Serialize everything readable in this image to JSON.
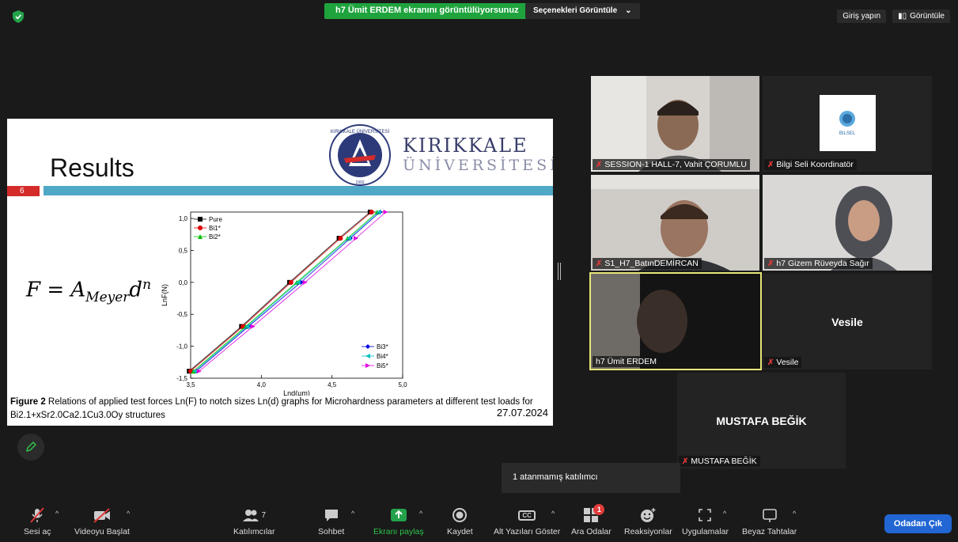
{
  "top": {
    "share_banner": "h7 Ümit ERDEM ekranını görüntülüyorsunuz",
    "view_options": "Seçenekleri Görüntüle",
    "signin": "Giriş yapın",
    "view": "Görüntüle"
  },
  "slide": {
    "title": "Results",
    "slide_number": "6",
    "university_line1": "KIRIKKALE",
    "university_line2": "ÜNİVERSİTESİ",
    "seal_text": "KIRIKKALE ÜNİVERSİTESİ",
    "seal_year": "1992",
    "formula_F": "F",
    "formula_eq": "=",
    "formula_A": "A",
    "formula_sub": "Meyer",
    "formula_d": "d",
    "formula_n": "n",
    "caption_bold": "Figure 2",
    "caption_text": " Relations of applied test forces Ln(F) to notch sizes Ln(d) graphs for Microhardness parameters at different test loads for",
    "caption_formula": "Bi2.1+xSr2.0Ca2.1Cu3.0Oy structures",
    "date": "27.07.2024"
  },
  "chart_data": {
    "type": "scatter",
    "xlabel": "Lnd(µm)",
    "ylabel": "LnF(N)",
    "xlim": [
      3.5,
      5.0
    ],
    "ylim": [
      -1.5,
      1.1
    ],
    "xticks": [
      "3,5",
      "4,0",
      "4,5",
      "5,0"
    ],
    "yticks": [
      "-1,5",
      "-1,0",
      "-0,5",
      "0,0",
      "0,5",
      "1,0"
    ],
    "x_tick_values": [
      3.5,
      4.0,
      4.5,
      5.0
    ],
    "y_tick_values": [
      -1.5,
      -1.0,
      -0.5,
      0.0,
      0.5,
      1.0
    ],
    "y_points": [
      -1.39,
      -0.69,
      0.0,
      0.69,
      1.1
    ],
    "series": [
      {
        "name": "Pure",
        "color": "#000000",
        "marker": "square",
        "x": [
          3.49,
          3.86,
          4.2,
          4.55,
          4.77
        ]
      },
      {
        "name": "Bi1*",
        "color": "#e00000",
        "marker": "circle",
        "x": [
          3.5,
          3.87,
          4.21,
          4.56,
          4.78
        ]
      },
      {
        "name": "Bi2*",
        "color": "#00c000",
        "marker": "triangle-up",
        "x": [
          3.52,
          3.89,
          4.25,
          4.61,
          4.82
        ]
      },
      {
        "name": "Bi3*",
        "color": "#0000e0",
        "marker": "diamond",
        "x": [
          3.54,
          3.91,
          4.28,
          4.63,
          4.84
        ]
      },
      {
        "name": "Bi4*",
        "color": "#00c0c0",
        "marker": "triangle-left",
        "x": [
          3.53,
          3.9,
          4.26,
          4.62,
          4.83
        ]
      },
      {
        "name": "Bi5*",
        "color": "#e000e0",
        "marker": "triangle-right",
        "x": [
          3.56,
          3.94,
          4.31,
          4.67,
          4.88
        ]
      }
    ]
  },
  "participants": {
    "vahit": "SESSION-1 HALL-7, Vahit ÇORUMLU",
    "bilgi": "Bilgi Seli Koordinatör",
    "bilsel_logo_text": "BILSEL",
    "batin": "S1_H7_BatınDEMİRCAN",
    "gizem": "h7 Gizem Rüveyda Sağır",
    "umit": "h7 Ümit ERDEM",
    "vesile_center": "Vesile",
    "vesile": "Vesile",
    "mustafa_center": "MUSTAFA BEĞİK",
    "mustafa": "MUSTAFA BEĞİK"
  },
  "tooltip": "1 atanmamış katılımcı",
  "toolbar": {
    "mute": "Sesi aç",
    "video": "Videoyu Başlat",
    "participants": "Katılımcılar",
    "participants_count": "7",
    "chat": "Sohbet",
    "share": "Ekranı paylaş",
    "record": "Kaydet",
    "cc": "Alt Yazıları Göster",
    "cc_icon": "CC",
    "breakout": "Ara Odalar",
    "breakout_badge": "1",
    "reactions": "Reaksiyonlar",
    "apps": "Uygulamalar",
    "whiteboard": "Beyaz Tahtalar",
    "leave": "Odadan Çık"
  },
  "colors": {
    "share_green": "#1fa33d",
    "leave_blue": "#2166d3",
    "active_speaker": "#e7e77a",
    "slide_red": "#d42b2b",
    "slide_blue": "#4fa8c5"
  }
}
